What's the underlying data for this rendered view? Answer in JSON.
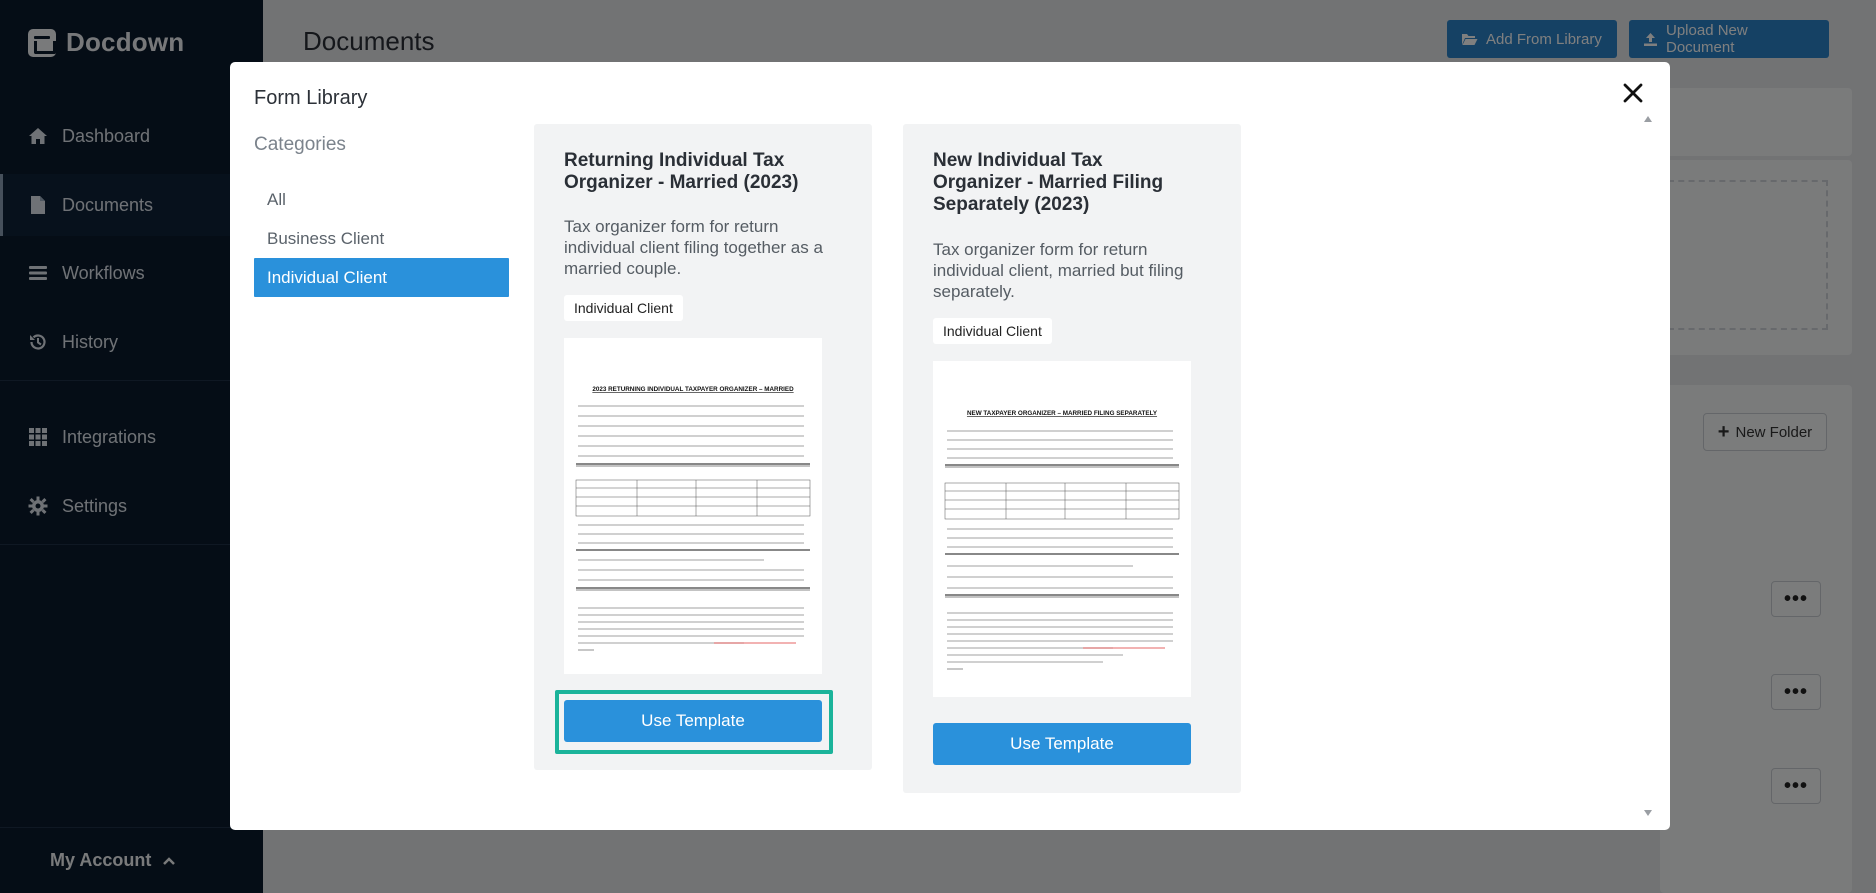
{
  "app": {
    "name": "Docdown"
  },
  "sidebar": {
    "items": [
      {
        "label": "Dashboard",
        "icon": "home-icon"
      },
      {
        "label": "Documents",
        "icon": "document-icon",
        "active": true
      },
      {
        "label": "Workflows",
        "icon": "list-icon"
      },
      {
        "label": "History",
        "icon": "history-icon"
      },
      {
        "label": "Integrations",
        "icon": "grid-icon"
      },
      {
        "label": "Settings",
        "icon": "gear-icon"
      }
    ],
    "account_label": "My Account"
  },
  "page": {
    "title": "Documents",
    "add_from_library": "Add From Library",
    "upload_new": "Upload New Document",
    "new_folder": "New Folder",
    "more_label": "•••"
  },
  "modal": {
    "title": "Form Library",
    "categories_title": "Categories",
    "categories": [
      "All",
      "Business Client",
      "Individual Client"
    ],
    "active_category": "Individual Client",
    "cards": [
      {
        "title": "Returning Individual Tax Organizer - Married (2023)",
        "description": "Tax organizer form for return individual client filing together as a married couple.",
        "tag": "Individual Client",
        "preview_heading": "2023 RETURNING INDIVIDUAL TAXPAYER ORGANIZER – MARRIED",
        "button": "Use Template"
      },
      {
        "title": "New Individual Tax Organizer - Married Filing Separately (2023)",
        "description": "Tax organizer form for return individual client, married but filing separately.",
        "tag": "Individual Client",
        "preview_heading": "NEW TAXPAYER ORGANIZER – MARRIED FILING SEPARATELY",
        "button": "Use Template"
      }
    ]
  },
  "colors": {
    "sidebar": "#0b1a2c",
    "primary": "#2a91db",
    "highlight": "#1bb39a"
  }
}
